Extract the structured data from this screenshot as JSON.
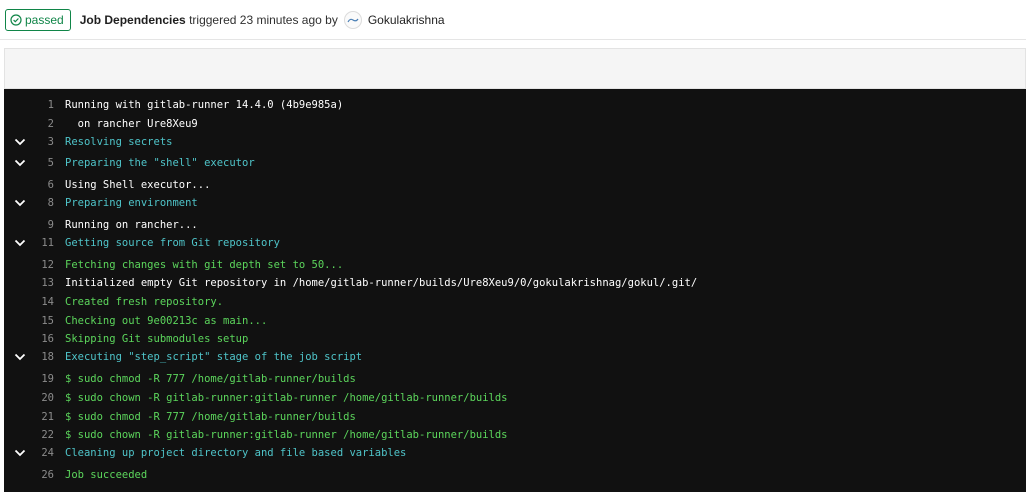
{
  "header": {
    "status": "passed",
    "job_name": "Job Dependencies",
    "trigger_text": "triggered 23 minutes ago by",
    "user": "Gokulakrishna"
  },
  "colors": {
    "success": "#108548",
    "log_bg": "#111111",
    "section_header": "#4fc4c9",
    "success_output": "#5cd65c",
    "default_output": "#ffffff"
  },
  "log": [
    {
      "n": "1",
      "text": "Running with gitlab-runner 14.4.0 (4b9e985a)",
      "color": "white",
      "section": false
    },
    {
      "n": "2",
      "text": "  on rancher Ure8Xeu9",
      "color": "white",
      "section": false
    },
    {
      "n": "3",
      "text": "Resolving secrets",
      "color": "cyan",
      "section": true
    },
    {
      "n": "5",
      "text": "Preparing the \"shell\" executor",
      "color": "cyan",
      "section": true
    },
    {
      "n": "6",
      "text": "Using Shell executor...",
      "color": "white",
      "section": false
    },
    {
      "n": "8",
      "text": "Preparing environment",
      "color": "cyan",
      "section": true
    },
    {
      "n": "9",
      "text": "Running on rancher...",
      "color": "white",
      "section": false
    },
    {
      "n": "11",
      "text": "Getting source from Git repository",
      "color": "cyan",
      "section": true
    },
    {
      "n": "12",
      "text": "Fetching changes with git depth set to 50...",
      "color": "green",
      "section": false
    },
    {
      "n": "13",
      "text": "Initialized empty Git repository in /home/gitlab-runner/builds/Ure8Xeu9/0/gokulakrishnag/gokul/.git/",
      "color": "white",
      "section": false
    },
    {
      "n": "14",
      "text": "Created fresh repository.",
      "color": "green",
      "section": false
    },
    {
      "n": "15",
      "text": "Checking out 9e00213c as main...",
      "color": "green",
      "section": false
    },
    {
      "n": "16",
      "text": "Skipping Git submodules setup",
      "color": "green",
      "section": false
    },
    {
      "n": "18",
      "text": "Executing \"step_script\" stage of the job script",
      "color": "cyan",
      "section": true
    },
    {
      "n": "19",
      "text": "$ sudo chmod -R 777 /home/gitlab-runner/builds",
      "color": "green",
      "section": false
    },
    {
      "n": "20",
      "text": "$ sudo chown -R gitlab-runner:gitlab-runner /home/gitlab-runner/builds",
      "color": "green",
      "section": false
    },
    {
      "n": "21",
      "text": "$ sudo chmod -R 777 /home/gitlab-runner/builds",
      "color": "green",
      "section": false
    },
    {
      "n": "22",
      "text": "$ sudo chown -R gitlab-runner:gitlab-runner /home/gitlab-runner/builds",
      "color": "green",
      "section": false
    },
    {
      "n": "24",
      "text": "Cleaning up project directory and file based variables",
      "color": "cyan",
      "section": true
    },
    {
      "n": "26",
      "text": "Job succeeded",
      "color": "green",
      "section": false
    }
  ]
}
